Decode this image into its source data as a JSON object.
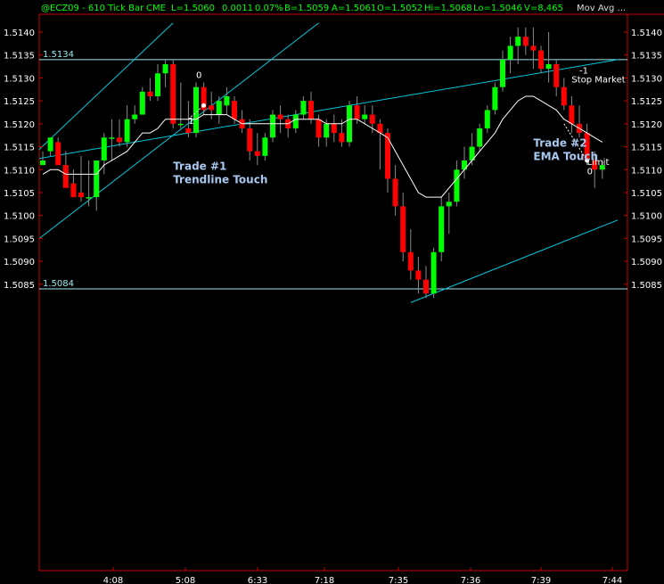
{
  "header": {
    "symbol": "@ECZ09 - 610 Tick Bar",
    "exchange": "CME",
    "last": "L=1.5060",
    "change": "0.0011",
    "change_pct": "0.07%",
    "bid": "B=1.5059",
    "ask": "A=1.5061",
    "open": "O=1.5052",
    "high": "Hi=1.5068",
    "low": "Lo=1.5046",
    "volume": "V=8,465",
    "study": "Mov Avg ..."
  },
  "colors": {
    "background": "#000000",
    "up_candle": "#00ff00",
    "down_candle": "#ff0000",
    "trendline": "#00c8dc",
    "level_line": "#9be8f0",
    "ema": "#ffffff",
    "axis": "#cc0000",
    "axis_text": "#ffffff",
    "header_text": "#00ff00",
    "annotation_text": "#a8c8f0"
  },
  "chart_data": {
    "type": "candlestick",
    "ylim": [
      1.5081,
      1.5142
    ],
    "y_ticks": [
      "1.5140",
      "1.5135",
      "1.5130",
      "1.5125",
      "1.5120",
      "1.5115",
      "1.5110",
      "1.5105",
      "1.5100",
      "1.5095",
      "1.5090",
      "1.5085"
    ],
    "x_ticks": [
      "4:08",
      "5:08",
      "6:33",
      "7:18",
      "7:35",
      "7:36",
      "7:39",
      "7:44"
    ],
    "level_lines": [
      {
        "label": "1.5134",
        "value": 1.5134
      },
      {
        "label": "1.5084",
        "value": 1.5084
      }
    ],
    "candles": [
      [
        1.5111,
        1.5114,
        1.5112,
        1.5111
      ],
      [
        1.5114,
        1.5117,
        1.5117,
        1.5113
      ],
      [
        1.5116,
        1.5117,
        1.5111,
        1.5112
      ],
      [
        1.5111,
        1.5114,
        1.5106,
        1.5107
      ],
      [
        1.5107,
        1.511,
        1.5104,
        1.5105
      ],
      [
        1.5105,
        1.5113,
        1.5104,
        1.5103
      ],
      [
        1.5104,
        1.5112,
        1.5104,
        1.5102
      ],
      [
        1.5104,
        1.5112,
        1.5112,
        1.5101
      ],
      [
        1.5112,
        1.5118,
        1.5117,
        1.5109
      ],
      [
        1.5117,
        1.5121,
        1.5117,
        1.5112
      ],
      [
        1.5117,
        1.5121,
        1.5116,
        1.5115
      ],
      [
        1.5116,
        1.5124,
        1.5121,
        1.5115
      ],
      [
        1.5121,
        1.5124,
        1.5122,
        1.512
      ],
      [
        1.5122,
        1.5128,
        1.5127,
        1.5122
      ],
      [
        1.5127,
        1.513,
        1.5126,
        1.5125
      ],
      [
        1.5126,
        1.5133,
        1.5131,
        1.5125
      ],
      [
        1.5131,
        1.5134,
        1.5133,
        1.5128
      ],
      [
        1.5133,
        1.5134,
        1.512,
        1.5119
      ],
      [
        1.512,
        1.5129,
        1.512,
        1.5119
      ],
      [
        1.5119,
        1.5125,
        1.5118,
        1.5117
      ],
      [
        1.5118,
        1.5129,
        1.5128,
        1.5117
      ],
      [
        1.5128,
        1.5129,
        1.5123,
        1.5122
      ],
      [
        1.5124,
        1.5127,
        1.5123,
        1.5121
      ],
      [
        1.5122,
        1.5126,
        1.5125,
        1.512
      ],
      [
        1.5124,
        1.5128,
        1.5126,
        1.5122
      ],
      [
        1.5125,
        1.5126,
        1.5121,
        1.512
      ],
      [
        1.5121,
        1.5123,
        1.5119,
        1.5118
      ],
      [
        1.5119,
        1.5121,
        1.5114,
        1.5112
      ],
      [
        1.5114,
        1.5118,
        1.5113,
        1.5111
      ],
      [
        1.5113,
        1.5118,
        1.5117,
        1.5112
      ],
      [
        1.5117,
        1.5123,
        1.5122,
        1.5116
      ],
      [
        1.5122,
        1.5124,
        1.5121,
        1.5118
      ],
      [
        1.5121,
        1.5122,
        1.5119,
        1.5117
      ],
      [
        1.5119,
        1.5123,
        1.5122,
        1.5118
      ],
      [
        1.5122,
        1.5126,
        1.5125,
        1.5121
      ],
      [
        1.5125,
        1.5127,
        1.5121,
        1.512
      ],
      [
        1.5121,
        1.5122,
        1.5117,
        1.5115
      ],
      [
        1.5117,
        1.5121,
        1.512,
        1.5115
      ],
      [
        1.512,
        1.5122,
        1.5118,
        1.5116
      ],
      [
        1.5118,
        1.5121,
        1.5116,
        1.5115
      ],
      [
        1.5116,
        1.5125,
        1.5124,
        1.5115
      ],
      [
        1.5124,
        1.5126,
        1.5121,
        1.512
      ],
      [
        1.5121,
        1.5124,
        1.5122,
        1.512
      ],
      [
        1.5122,
        1.5124,
        1.512,
        1.5118
      ],
      [
        1.512,
        1.5121,
        1.5118,
        1.511
      ],
      [
        1.5118,
        1.5119,
        1.5108,
        1.5105
      ],
      [
        1.5108,
        1.5111,
        1.5102,
        1.51
      ],
      [
        1.5102,
        1.5105,
        1.5092,
        1.509
      ],
      [
        1.5092,
        1.5097,
        1.5088,
        1.5086
      ],
      [
        1.5088,
        1.5091,
        1.5086,
        1.5083
      ],
      [
        1.5086,
        1.5089,
        1.5083,
        1.5082
      ],
      [
        1.5083,
        1.5093,
        1.5092,
        1.5082
      ],
      [
        1.5092,
        1.5104,
        1.5102,
        1.509
      ],
      [
        1.5102,
        1.5105,
        1.5103,
        1.5096
      ],
      [
        1.5103,
        1.5112,
        1.511,
        1.5102
      ],
      [
        1.511,
        1.5115,
        1.5112,
        1.5108
      ],
      [
        1.5112,
        1.5118,
        1.5115,
        1.5111
      ],
      [
        1.5115,
        1.512,
        1.5119,
        1.5114
      ],
      [
        1.5119,
        1.5124,
        1.5123,
        1.5118
      ],
      [
        1.5123,
        1.5129,
        1.5128,
        1.5122
      ],
      [
        1.5128,
        1.5136,
        1.5134,
        1.5127
      ],
      [
        1.5134,
        1.5139,
        1.5137,
        1.5131
      ],
      [
        1.5137,
        1.5141,
        1.5139,
        1.5133
      ],
      [
        1.5139,
        1.5141,
        1.5137,
        1.5135
      ],
      [
        1.5137,
        1.5141,
        1.5136,
        1.5132
      ],
      [
        1.5136,
        1.5137,
        1.5132,
        1.5131
      ],
      [
        1.5132,
        1.514,
        1.5133,
        1.5129
      ],
      [
        1.5133,
        1.5134,
        1.5128,
        1.5126
      ],
      [
        1.5128,
        1.513,
        1.5124,
        1.5123
      ],
      [
        1.5124,
        1.5126,
        1.512,
        1.5118
      ],
      [
        1.512,
        1.5124,
        1.5118,
        1.5117
      ],
      [
        1.5118,
        1.512,
        1.5112,
        1.5111
      ],
      [
        1.5112,
        1.5114,
        1.511,
        1.5106
      ],
      [
        1.511,
        1.5112,
        1.5111,
        1.5108
      ]
    ],
    "ema": [
      1.5109,
      1.511,
      1.511,
      1.5109,
      1.5109,
      1.5109,
      1.5109,
      1.5109,
      1.5111,
      1.5112,
      1.5113,
      1.5114,
      1.5116,
      1.5118,
      1.5118,
      1.5119,
      1.5121,
      1.5121,
      1.5121,
      1.5121,
      1.5121,
      1.5122,
      1.5122,
      1.5122,
      1.5122,
      1.5121,
      1.512,
      1.512,
      1.512,
      1.512,
      1.512,
      1.512,
      1.512,
      1.5121,
      1.5121,
      1.5121,
      1.5121,
      1.512,
      1.512,
      1.512,
      1.5121,
      1.5121,
      1.512,
      1.5119,
      1.5118,
      1.5117,
      1.5114,
      1.5111,
      1.5108,
      1.5105,
      1.5104,
      1.5104,
      1.5104,
      1.5106,
      1.5108,
      1.511,
      1.5112,
      1.5114,
      1.5116,
      1.5118,
      1.5121,
      1.5123,
      1.5125,
      1.5126,
      1.5126,
      1.5125,
      1.5124,
      1.5123,
      1.5121,
      1.512,
      1.5119,
      1.5118,
      1.5117,
      1.5116
    ],
    "trendlines": [
      {
        "from": [
          -2,
          1.5112
        ],
        "to": [
          17,
          1.5142
        ]
      },
      {
        "from": [
          -2,
          1.5093
        ],
        "to": [
          36,
          1.5142
        ]
      },
      {
        "from": [
          -2,
          1.5112
        ],
        "to": [
          75,
          1.5134
        ]
      },
      {
        "from": [
          48,
          1.5081
        ],
        "to": [
          75,
          1.5099
        ]
      }
    ],
    "annotations": [
      {
        "line1": "Trade #1",
        "line2": "Trendline Touch",
        "at": [
          17,
          1.511
        ]
      },
      {
        "line1": "Trade #2",
        "line2": "EMA Touch",
        "at": [
          64,
          1.5115
        ]
      }
    ],
    "markers": [
      {
        "text": "0",
        "at": [
          20,
          1.513
        ]
      },
      {
        "text": "1",
        "at": [
          19,
          1.512
        ]
      },
      {
        "text": "-1",
        "at": [
          70,
          1.5131
        ]
      },
      {
        "text": "Stop Market",
        "at": [
          69,
          1.5129
        ]
      },
      {
        "text": "Limit",
        "at": [
          71,
          1.5111
        ]
      },
      {
        "text": "0",
        "at": [
          71,
          1.5109
        ]
      }
    ],
    "trade_arrows": [
      {
        "from": [
          19,
          1.5121
        ],
        "to": [
          21,
          1.5124
        ]
      },
      {
        "from": [
          68,
          1.512
        ],
        "to": [
          71,
          1.5112
        ]
      }
    ]
  }
}
